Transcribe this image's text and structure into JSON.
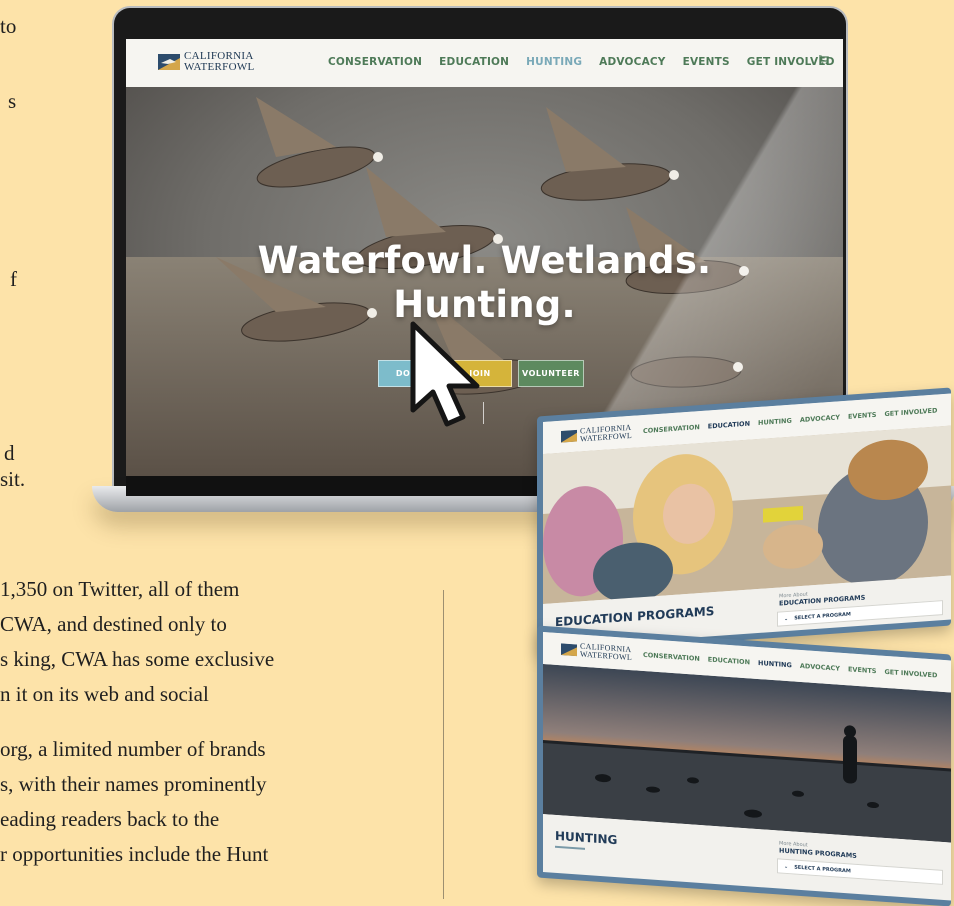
{
  "article": {
    "fragments": [
      " to",
      "s",
      "f",
      "d",
      "sit.",
      " 1,350 on Twitter, all of them",
      " CWA, and destined only to",
      "s king, CWA has some exclusive",
      "n it on its web and social",
      "org, a limited number of brands",
      "s, with their names prominently",
      "eading readers back to the",
      "r opportunities include the Hunt"
    ]
  },
  "site": {
    "logo_line1": "CALIFORNIA",
    "logo_line2": "WATERFOWL",
    "nav": [
      "CONSERVATION",
      "EDUCATION",
      "HUNTING",
      "ADVOCACY",
      "EVENTS",
      "GET INVOLVED"
    ],
    "nav_active": "HUNTING",
    "cart_icon": "cart-icon",
    "hero_line1": "Waterfowl. Wetlands.",
    "hero_line2": "Hunting.",
    "buttons": [
      {
        "label": "DONA",
        "color": "#7dbccb"
      },
      {
        "label": "JOIN",
        "color": "#d5b43a"
      },
      {
        "label": "VOLUNTEER",
        "color": "#5d8a5f"
      }
    ]
  },
  "education_card": {
    "nav": [
      "CONSERVATION",
      "EDUCATION",
      "HUNTING",
      "ADVOCACY",
      "EVENTS",
      "GET INVOLVED"
    ],
    "title": "EDUCATION PROGRAMS",
    "more_label": "More About",
    "sub_title": "EDUCATION PROGRAMS",
    "select_label": "SELECT A PROGRAM"
  },
  "hunting_card": {
    "nav": [
      "CONSERVATION",
      "EDUCATION",
      "HUNTING",
      "ADVOCACY",
      "EVENTS",
      "GET INVOLVED"
    ],
    "title": "HUNTING",
    "more_label": "More About",
    "sub_title": "HUNTING PROGRAMS",
    "select_label": "SELECT A PROGRAM"
  },
  "colors": {
    "background": "#fde3a9",
    "nav_green": "#4e7a58",
    "nav_active": "#7aa9b8",
    "navy": "#213b58",
    "card_frame": "#5b7f9f"
  }
}
